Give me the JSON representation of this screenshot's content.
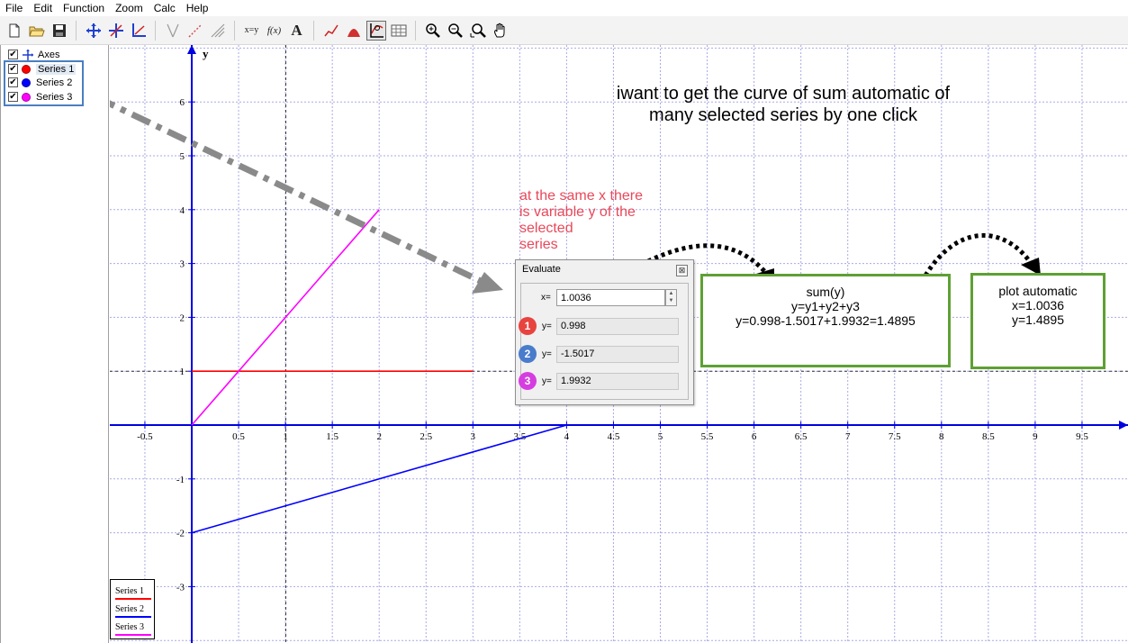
{
  "menu": [
    "File",
    "Edit",
    "Function",
    "Zoom",
    "Calc",
    "Help"
  ],
  "toolbar": {
    "xy_label": "x=y",
    "fx_label": "f(x)",
    "text_label": "A"
  },
  "tree": {
    "items": [
      {
        "label": "Axes",
        "checked": "✔"
      },
      {
        "label": "Series 1",
        "checked": "✔",
        "color": "#ff0000"
      },
      {
        "label": "Series 2",
        "checked": "✔",
        "color": "#0000ff"
      },
      {
        "label": "Series 3",
        "checked": "✔",
        "color": "#ff00ff"
      }
    ]
  },
  "chart_data": {
    "type": "line",
    "xlabel": "",
    "ylabel": "y",
    "xlim": [
      -0.9,
      9.9
    ],
    "ylim": [
      -4,
      7
    ],
    "x_ticks": [
      "-0.5",
      "0.5",
      "1",
      "1.5",
      "2",
      "2.5",
      "3",
      "3.5",
      "4",
      "4.5",
      "5",
      "5.5",
      "6",
      "6.5",
      "7",
      "7.5",
      "8",
      "8.5",
      "9",
      "9.5"
    ],
    "y_ticks": [
      "6",
      "5",
      "4",
      "3",
      "2",
      "1",
      "-1",
      "-2",
      "-3"
    ],
    "series": [
      {
        "name": "Series 1",
        "color": "#ff0000",
        "x": [
          0,
          3
        ],
        "y": [
          1,
          1
        ]
      },
      {
        "name": "Series 2",
        "color": "#0000ff",
        "x": [
          0,
          4
        ],
        "y": [
          -2,
          0
        ]
      },
      {
        "name": "Series 3",
        "color": "#ff00ff",
        "x": [
          0,
          2
        ],
        "y": [
          0,
          4
        ]
      }
    ],
    "trace_x": 1.0036,
    "trace_y": 1
  },
  "evaluate": {
    "title": "Evaluate",
    "close": "⊠",
    "x_label": "x=",
    "x_value": "1.0036",
    "y_label": "y=",
    "rows": [
      {
        "num": "1",
        "value": "0.998",
        "color": "#e8433f"
      },
      {
        "num": "2",
        "value": "-1.5017",
        "color": "#4a7ccc"
      },
      {
        "num": "3",
        "value": "1.9932",
        "color": "#d63de0"
      }
    ]
  },
  "annotations": {
    "headline_1": "iwant to get the curve of sum automatic of",
    "headline_2": "many  selected series by one click",
    "note_lines": [
      "at the same x there",
      "is variable y of the",
      "selected",
      "series"
    ],
    "sum_box": [
      "sum(y)",
      "y=y1+y2+y3",
      "y=0.998-1.5017+1.9932=1.4895"
    ],
    "plot_box": [
      "plot automatic",
      "x=1.0036",
      "y=1.4895"
    ]
  },
  "legend": [
    "Series 1",
    "Series 2",
    "Series 3"
  ]
}
